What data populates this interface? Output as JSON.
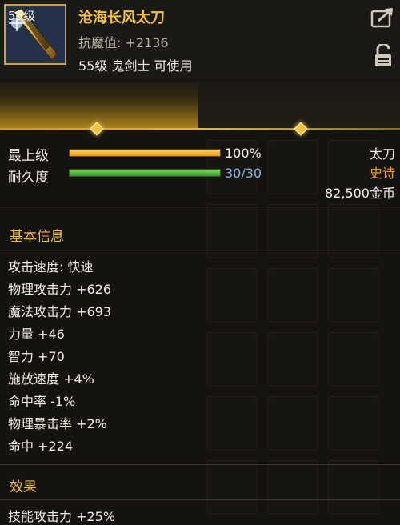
{
  "item": {
    "level_badge": "55级",
    "name": "沧海长风太刀",
    "resist": "抗魔值: +2136",
    "requirement": "55级 鬼剑士 可使用"
  },
  "stats": {
    "max_label": "最上级",
    "max_value": "100%",
    "max_fraction": 1.0,
    "durability_label": "耐久度",
    "durability_value": "30/30",
    "durability_fraction": 1.0
  },
  "details": {
    "type": "太刀",
    "rarity": "史诗",
    "price": "82,500金币"
  },
  "basic_info": {
    "title": "基本信息",
    "lines": [
      "攻击速度: 快速",
      "物理攻击力 +626",
      "魔法攻击力 +693",
      "力量 +46",
      "智力 +70",
      "施放速度 +4%",
      "命中率 -1%",
      "物理暴击率 +2%",
      "命中 +224"
    ]
  },
  "effect": {
    "title": "效果",
    "first_line": "技能攻击力 +25%"
  },
  "icons": {
    "share": "share-icon",
    "lock": "unlock-icon"
  },
  "colors": {
    "gold": "#f2c240",
    "epic": "#f0a020",
    "durability_blue": "#8fb0d8"
  }
}
